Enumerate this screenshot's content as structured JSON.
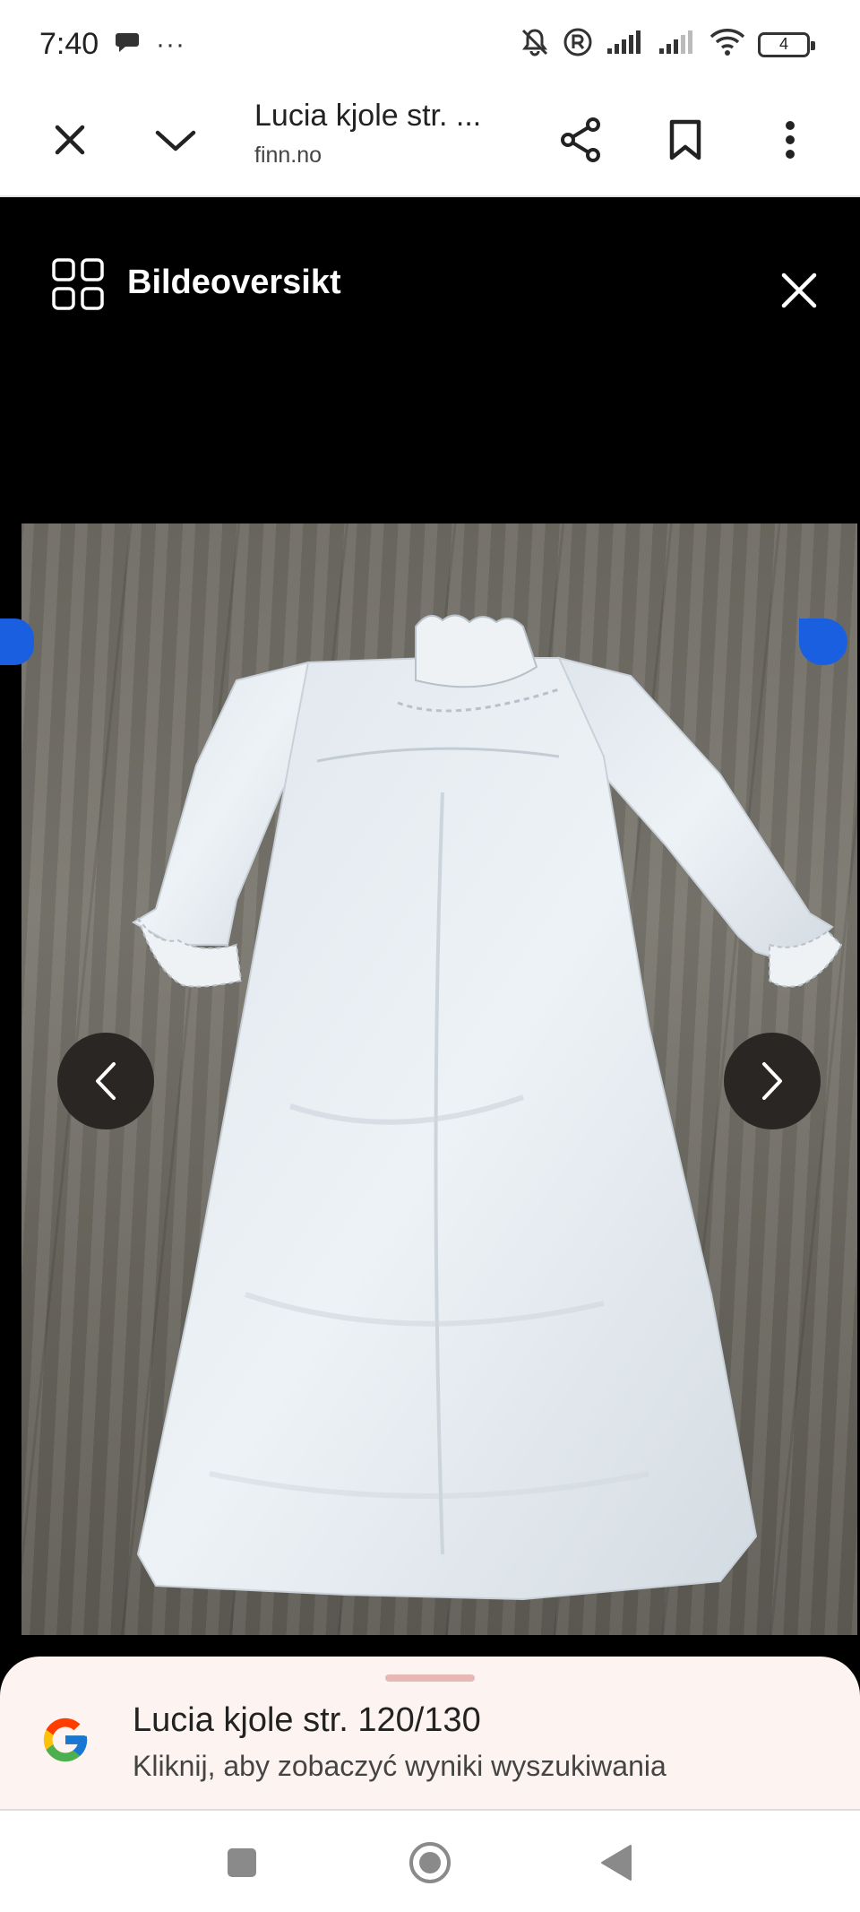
{
  "status_bar": {
    "time": "7:40",
    "more_dots": "···",
    "battery_level": "4"
  },
  "toolbar": {
    "title": "Lucia kjole str. ...",
    "domain": "finn.no"
  },
  "viewer": {
    "title": "Bildeoversikt"
  },
  "bottom_sheet": {
    "title": "Lucia kjole str. 120/130",
    "subtitle": "Kliknij, aby zobaczyć wyniki wyszukiwania"
  },
  "colors": {
    "accent_blue": "#1a5fe0",
    "viewer_bg": "#000000",
    "sheet_bg": "#fdf3f1"
  }
}
